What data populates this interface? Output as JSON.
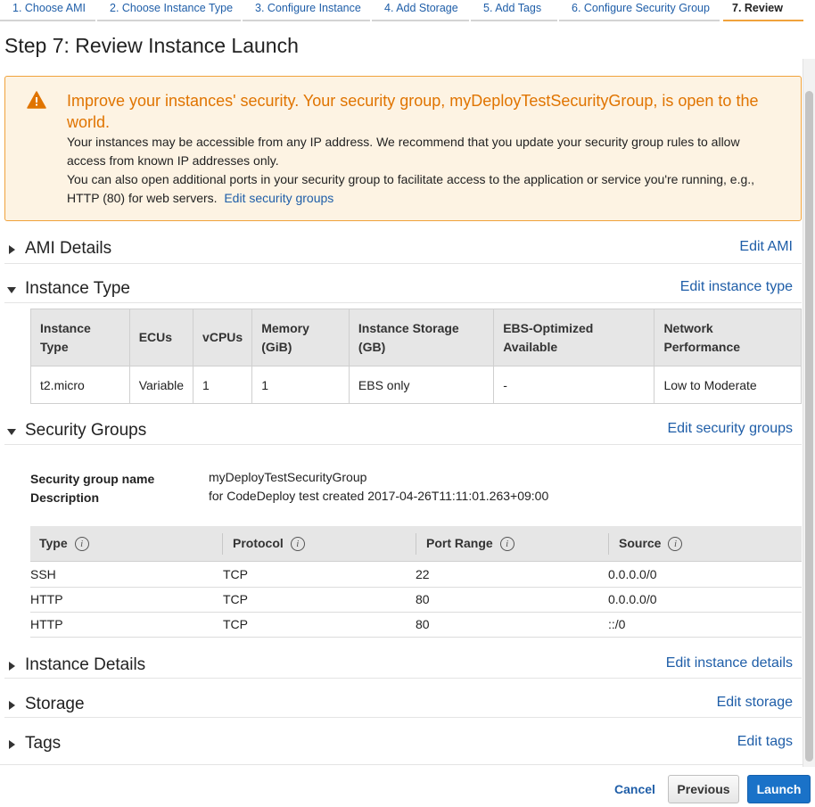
{
  "tabs": [
    {
      "label": "1. Choose AMI"
    },
    {
      "label": "2. Choose Instance Type"
    },
    {
      "label": "3. Configure Instance"
    },
    {
      "label": "4. Add Storage"
    },
    {
      "label": "5. Add Tags"
    },
    {
      "label": "6. Configure Security Group"
    },
    {
      "label": "7. Review",
      "active": true
    }
  ],
  "page_title": "Step 7: Review Instance Launch",
  "warning": {
    "title": "Improve your instances' security. Your security group, myDeployTestSecurityGroup, is open to the world.",
    "body_1": "Your instances may be accessible from any IP address. We recommend that you update your security group rules to allow access from known IP addresses only.",
    "body_2": "You can also open additional ports in your security group to facilitate access to the application or service you're running, e.g., HTTP (80) for web servers.",
    "link": "Edit security groups",
    "icon": "warning-triangle-icon",
    "color": "#e07400"
  },
  "sections": {
    "ami": {
      "title": "AMI Details",
      "edit": "Edit AMI",
      "expanded": false
    },
    "instance_type": {
      "title": "Instance Type",
      "edit": "Edit instance type",
      "expanded": true
    },
    "security_groups": {
      "title": "Security Groups",
      "edit": "Edit security groups",
      "expanded": true
    },
    "instance_details": {
      "title": "Instance Details",
      "edit": "Edit instance details",
      "expanded": false
    },
    "storage": {
      "title": "Storage",
      "edit": "Edit storage",
      "expanded": false
    },
    "tags": {
      "title": "Tags",
      "edit": "Edit tags",
      "expanded": false
    }
  },
  "instance_type_table": {
    "headers": [
      "Instance Type",
      "ECUs",
      "vCPUs",
      "Memory (GiB)",
      "Instance Storage (GB)",
      "EBS-Optimized Available",
      "Network Performance"
    ],
    "row": [
      "t2.micro",
      "Variable",
      "1",
      "1",
      "EBS only",
      "-",
      "Low to Moderate"
    ]
  },
  "security_group": {
    "name_label": "Security group name",
    "name_value": "myDeployTestSecurityGroup",
    "desc_label": "Description",
    "desc_value": "for CodeDeploy test created 2017-04-26T11:11:01.263+09:00"
  },
  "rules_table": {
    "headers": [
      "Type",
      "Protocol",
      "Port Range",
      "Source"
    ],
    "rows": [
      [
        "SSH",
        "TCP",
        "22",
        "0.0.0.0/0"
      ],
      [
        "HTTP",
        "TCP",
        "80",
        "0.0.0.0/0"
      ],
      [
        "HTTP",
        "TCP",
        "80",
        "::/0"
      ]
    ]
  },
  "footer": {
    "cancel": "Cancel",
    "previous": "Previous",
    "launch": "Launch",
    "launch_color": "#1a72c8"
  }
}
